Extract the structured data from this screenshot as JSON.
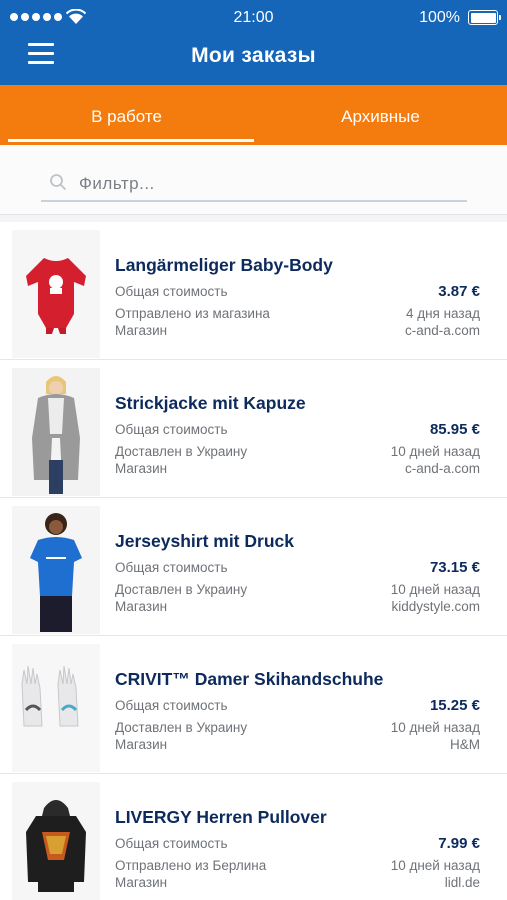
{
  "status_bar": {
    "time": "21:00",
    "battery": "100%",
    "signal_bars": 5
  },
  "header": {
    "title": "Мои заказы",
    "menu_icon": "hamburger-menu-icon"
  },
  "tabs": [
    {
      "label": "В работе",
      "active": true
    },
    {
      "label": "Архивные",
      "active": false
    }
  ],
  "filter": {
    "placeholder": "Фильтр...",
    "value": ""
  },
  "colors": {
    "header": "#1565b8",
    "tabs": "#f47b0e",
    "title_text": "#0d2a5c"
  },
  "orders": [
    {
      "name": "Langärmeliger Baby-Body",
      "total_label": "Общая стоимость",
      "price": "3.87 €",
      "status": "Отправлено из магазина",
      "time": "4 дня назад",
      "store_label": "Магазин",
      "store": "c-and-a.com",
      "image": "red-baby-bodysuit"
    },
    {
      "name": "Strickjacke mit Kapuze",
      "total_label": "Общая стоимость",
      "price": "85.95 €",
      "status": "Доставлен в Украину",
      "time": "10 дней назад",
      "store_label": "Магазин",
      "store": "c-and-a.com",
      "image": "grey-knit-cardigan"
    },
    {
      "name": "Jerseyshirt mit Druck",
      "total_label": "Общая стоимость",
      "price": "73.15 €",
      "status": "Доставлен в Украину",
      "time": "10 дней назад",
      "store_label": "Магазин",
      "store": "kiddystyle.com",
      "image": "blue-printed-tshirt"
    },
    {
      "name": "CRIVIT™ Damer Skihandschuhe",
      "total_label": "Общая стоимость",
      "price": "15.25 €",
      "status": "Доставлен в Украину",
      "time": "10 дней назад",
      "store_label": "Магазин",
      "store": "H&M",
      "image": "white-ski-gloves"
    },
    {
      "name": "LIVERGY Herren Pullover",
      "total_label": "Общая стоимость",
      "price": "7.99 €",
      "status": "Отправлено из Берлина",
      "time": "10 дней назад",
      "store_label": "Магазин",
      "store": "lidl.de",
      "image": "black-hoodie"
    }
  ]
}
